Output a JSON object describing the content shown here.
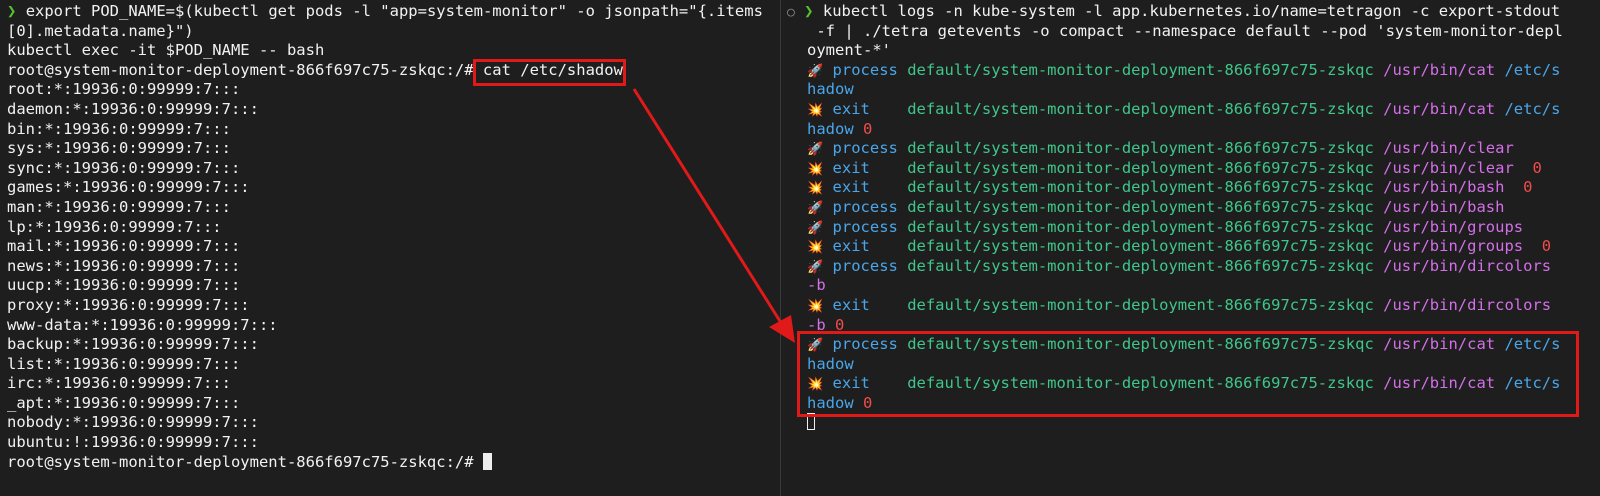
{
  "left_terminal": {
    "export_line_1": "export POD_NAME=$(kubectl get pods -l \"app=system-monitor\" -o jsonpath=\"{.items",
    "export_line_2": "[0].metadata.name}\")",
    "exec_line": "kubectl exec -it $POD_NAME -- bash",
    "prompt": "root@system-monitor-deployment-866f697c75-zskqc:/# ",
    "command": "cat /etc/shadow",
    "shadow_lines": [
      "root:*:19936:0:99999:7:::",
      "daemon:*:19936:0:99999:7:::",
      "bin:*:19936:0:99999:7:::",
      "sys:*:19936:0:99999:7:::",
      "sync:*:19936:0:99999:7:::",
      "games:*:19936:0:99999:7:::",
      "man:*:19936:0:99999:7:::",
      "lp:*:19936:0:99999:7:::",
      "mail:*:19936:0:99999:7:::",
      "news:*:19936:0:99999:7:::",
      "uucp:*:19936:0:99999:7:::",
      "proxy:*:19936:0:99999:7:::",
      "www-data:*:19936:0:99999:7:::",
      "backup:*:19936:0:99999:7:::",
      "list:*:19936:0:99999:7:::",
      "irc:*:19936:0:99999:7:::",
      "_apt:*:19936:0:99999:7:::",
      "nobody:*:19936:0:99999:7:::",
      "ubuntu:!:19936:0:99999:7:::"
    ],
    "final_prompt": "root@system-monitor-deployment-866f697c75-zskqc:/# "
  },
  "right_terminal": {
    "cmd_line_1": "kubectl logs -n kube-system -l app.kubernetes.io/name=tetragon -c export-stdout",
    "cmd_line_2": " -f | ./tetra getevents -o compact --namespace default --pod 'system-monitor-depl",
    "cmd_line_3": "oyment-*'",
    "pod": "default/system-monitor-deployment-866f697c75-zskqc",
    "events": {
      "e1": {
        "kind": "process",
        "bin": "/usr/bin/cat",
        "arg": "/etc/s",
        "cont": "hadow"
      },
      "e2": {
        "kind": "exit",
        "bin": "/usr/bin/cat",
        "arg": "/etc/s",
        "cont": "hadow",
        "code": "0"
      },
      "e3": {
        "kind": "process",
        "bin": "/usr/bin/clear"
      },
      "e4": {
        "kind": "exit",
        "bin": "/usr/bin/clear",
        "code": "0"
      },
      "e5": {
        "kind": "exit",
        "bin": "/usr/bin/bash",
        "code": "0"
      },
      "e6": {
        "kind": "process",
        "bin": "/usr/bin/bash"
      },
      "e7": {
        "kind": "process",
        "bin": "/usr/bin/groups"
      },
      "e8": {
        "kind": "exit",
        "bin": "/usr/bin/groups",
        "code": "0"
      },
      "e9": {
        "kind": "process",
        "bin": "/usr/bin/dircolors",
        "cont": "-b"
      },
      "e10": {
        "kind": "exit",
        "bin": "/usr/bin/dircolors",
        "cont": "-b",
        "code": "0"
      },
      "e11": {
        "kind": "process",
        "bin": "/usr/bin/cat",
        "arg": "/etc/s",
        "cont": "hadow"
      },
      "e12": {
        "kind": "exit",
        "bin": "/usr/bin/cat",
        "arg": "/etc/s",
        "cont": "hadow",
        "code": "0"
      }
    }
  },
  "icons": {
    "prompt": "chevron-right-icon",
    "process": "rocket-icon",
    "exit": "explosion-icon"
  },
  "colors": {
    "background": "#1e1e1e",
    "highlight": "#e01919",
    "pod": "#3fc68a",
    "process_label": "#4aa6ea",
    "binary": "#d36fe8",
    "exit_code": "#f14c4c",
    "prompt_arrow": "#56c22c"
  }
}
